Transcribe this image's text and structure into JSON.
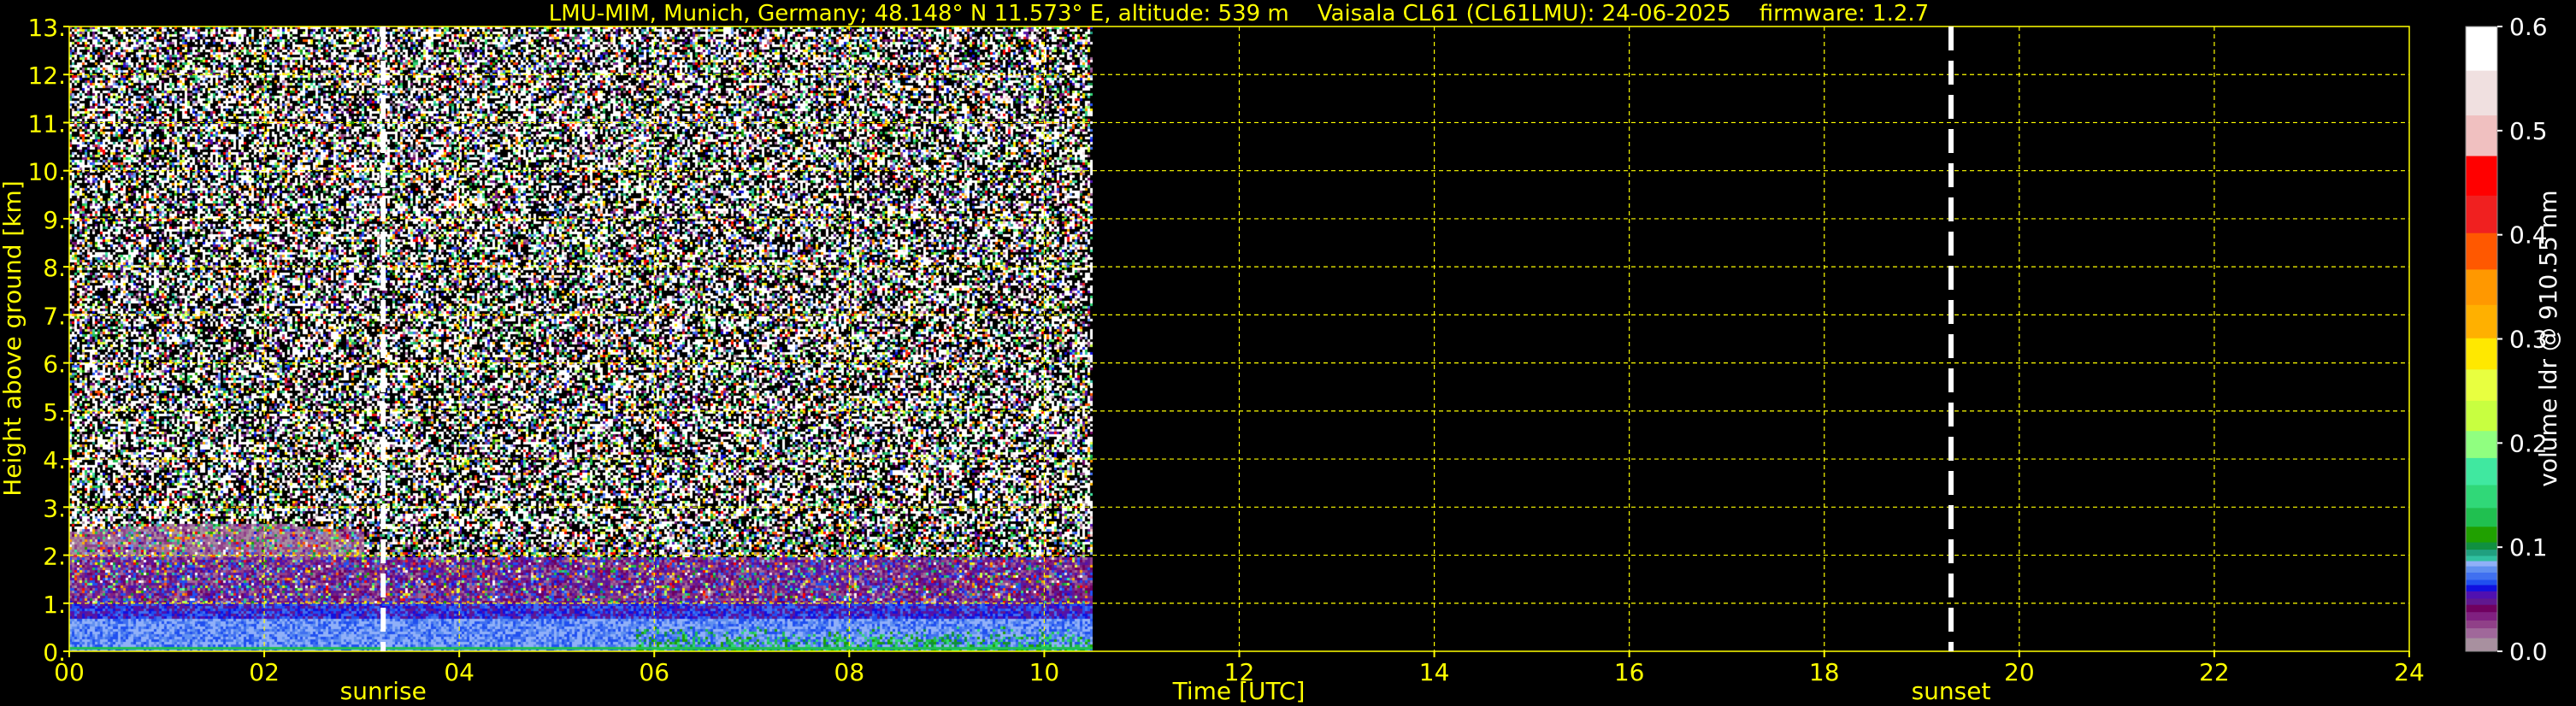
{
  "chart_data": {
    "type": "heatmap",
    "title": "LMU-MIM, Munich, Germany; 48.148° N 11.573° E, altitude: 539 m    Vaisala CL61 (CL61LMU): 24-06-2025    firmware: 1.2.7",
    "xlabel": "Time [UTC]",
    "ylabel": "Height above ground [km]",
    "xlim": [
      0,
      24
    ],
    "ylim": [
      0,
      13
    ],
    "x_ticks": [
      "00",
      "02",
      "04",
      "06",
      "08",
      "10",
      "12",
      "14",
      "16",
      "18",
      "20",
      "22",
      "24"
    ],
    "y_ticks": [
      "0.",
      "1.",
      "2.",
      "3.",
      "4.",
      "5.",
      "6.",
      "7.",
      "8.",
      "9.",
      "10.",
      "11.",
      "12.",
      "13."
    ],
    "grid": true,
    "data_end_hour": 10.5,
    "annotations": [
      {
        "label": "sunrise",
        "hour": 3.22
      },
      {
        "label": "sunset",
        "hour": 19.3
      }
    ],
    "colorbar": {
      "label": "volume ldr @ 910.55 nm",
      "range": [
        0,
        0.6
      ],
      "ticks": [
        "0.0",
        "0.1",
        "0.2",
        "0.3",
        "0.4",
        "0.5",
        "0.6"
      ],
      "edges": [
        0,
        0.013,
        0.0225,
        0.03,
        0.038,
        0.045,
        0.051,
        0.058,
        0.064,
        0.069,
        0.076,
        0.082,
        0.087,
        0.092,
        0.098,
        0.105,
        0.12,
        0.138,
        0.16,
        0.186,
        0.212,
        0.241,
        0.271,
        0.301,
        0.333,
        0.367,
        0.402,
        0.438,
        0.476,
        0.515,
        0.558,
        0.6
      ],
      "colors": [
        "#a8909f",
        "#a0689a",
        "#904088",
        "#802080",
        "#700060",
        "#601890",
        "#5010b0",
        "#1010e0",
        "#2050f0",
        "#4070f0",
        "#6090f0",
        "#90b0f8",
        "#30c0a0",
        "#20a080",
        "#109040",
        "#20a000",
        "#20c050",
        "#30d878",
        "#40e8a0",
        "#90ff80",
        "#c8ff40",
        "#e8ff40",
        "#ffe800",
        "#ffb000",
        "#ff9800",
        "#ff5800",
        "#f02020",
        "#ff0000",
        "#f0c0c0",
        "#f0e0e0",
        "#ffffff"
      ]
    },
    "layers_description_km": {
      "noise_above": 2.5,
      "mixed_layer_top": 2.0,
      "near_surface_top": 1.0
    }
  },
  "colors": {
    "axis": "#ffff00",
    "marker": "#ffffff",
    "background": "#000000"
  }
}
